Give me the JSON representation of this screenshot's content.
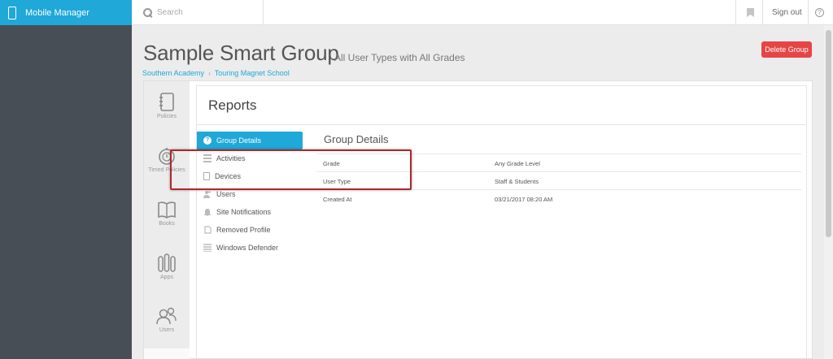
{
  "topbar": {
    "app_name": "Mobile Manager",
    "search_placeholder": "Search",
    "sign_out": "Sign out",
    "help": "?"
  },
  "header": {
    "title": "Sample Smart Group",
    "subtitle": "All User Types with All Grades",
    "breadcrumb": [
      "Southern Academy",
      "Touring Magnet School"
    ],
    "delete_label": "Delete Group"
  },
  "tools": [
    {
      "label": "Policies",
      "icon": "notebook-icon"
    },
    {
      "label": "Timed Policies",
      "icon": "timer-icon"
    },
    {
      "label": "Books",
      "icon": "book-icon"
    },
    {
      "label": "Apps",
      "icon": "apps-icon"
    },
    {
      "label": "Users",
      "icon": "users-icon"
    }
  ],
  "reports": {
    "title": "Reports",
    "menu": [
      {
        "label": "Group Details",
        "icon": "question-circle-icon",
        "active": true
      },
      {
        "label": "Activities",
        "icon": "list-icon"
      },
      {
        "label": "Devices",
        "icon": "device-icon"
      },
      {
        "label": "Users",
        "icon": "users-icon"
      },
      {
        "label": "Site Notifications",
        "icon": "bell-icon"
      },
      {
        "label": "Removed Profile",
        "icon": "removed-profile-icon"
      },
      {
        "label": "Windows Defender",
        "icon": "shield-icon"
      }
    ]
  },
  "group_details": {
    "title": "Group Details",
    "rows": [
      {
        "key": "Grade",
        "value": "Any Grade Level"
      },
      {
        "key": "User Type",
        "value": "Staff & Students"
      },
      {
        "key": "Created At",
        "value": "03/21/2017 08:20 AM"
      }
    ]
  },
  "colors": {
    "accent": "#1fa8d8",
    "danger": "#e74545",
    "sidebar": "#474e55",
    "highlight": "#b0262a"
  }
}
